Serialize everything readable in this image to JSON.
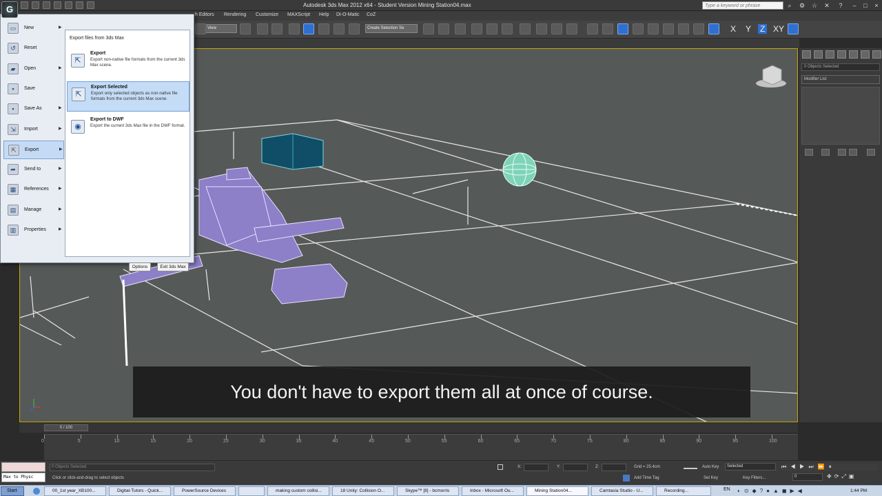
{
  "window": {
    "title": "Autodesk 3ds Max 2012 x64 - Student Version    Mining Station04.max"
  },
  "search": {
    "placeholder": "Type a keyword or phrase"
  },
  "menubar": {
    "items": [
      "h Editors",
      "Rendering",
      "Customize",
      "MAXScript",
      "Help",
      "Di-O-Matic",
      "CoZ"
    ]
  },
  "toolbar": {
    "view_label": "View",
    "selection_set": "Create Selection Se",
    "axes": [
      "X",
      "Y",
      "Z",
      "XY"
    ]
  },
  "app_menu": {
    "items": [
      {
        "label": "New",
        "icon": "new-file-icon",
        "arrow": true
      },
      {
        "label": "Reset",
        "icon": "reset-icon",
        "arrow": false
      },
      {
        "label": "Open",
        "icon": "open-folder-icon",
        "arrow": true
      },
      {
        "label": "Save",
        "icon": "save-icon",
        "arrow": false
      },
      {
        "label": "Save As",
        "icon": "save-as-icon",
        "arrow": true
      },
      {
        "label": "Import",
        "icon": "import-icon",
        "arrow": true
      },
      {
        "label": "Export",
        "icon": "export-icon",
        "arrow": true
      },
      {
        "label": "Send to",
        "icon": "send-to-icon",
        "arrow": true
      },
      {
        "label": "References",
        "icon": "references-icon",
        "arrow": true
      },
      {
        "label": "Manage",
        "icon": "manage-icon",
        "arrow": true
      },
      {
        "label": "Properties",
        "icon": "properties-icon",
        "arrow": true
      }
    ],
    "selected_index": 6,
    "submenu": {
      "header": "Export files from 3ds Max",
      "items": [
        {
          "title": "Export",
          "desc": "Export non-native file formats from the current 3ds Max scene."
        },
        {
          "title": "Export Selected",
          "desc": "Export only selected objects as non-native file formats from the current 3ds Max scene."
        },
        {
          "title": "Export to DWF",
          "desc": "Export the current 3ds Max file in the DWF format."
        }
      ]
    },
    "options_label": "Options",
    "exit_label": "Exit 3ds Max"
  },
  "command_panel": {
    "selection": "0 Objects Selected",
    "modifier_list": "Modifier List"
  },
  "caption": "You don't have to export them all at once of course.",
  "timeline": {
    "slider": "0 / 100",
    "ticks": [
      0,
      5,
      10,
      15,
      20,
      25,
      30,
      35,
      40,
      45,
      50,
      55,
      60,
      65,
      70,
      75,
      80,
      85,
      90,
      95,
      100
    ]
  },
  "status": {
    "maxscript": "Max to Physc",
    "objects_selected": "0 Objects Selected",
    "prompt": "Click or click-and-drag to select objects",
    "x_label": "X:",
    "y_label": "Y:",
    "z_label": "Z:",
    "grid": "Grid = 25.4cm",
    "add_time_tag": "Add Time Tag",
    "auto_key": "Auto Key",
    "set_key": "Set Key",
    "key_mode": "Selected",
    "key_filters": "Key Filters...",
    "frame": "0"
  },
  "taskbar": {
    "start": "Start",
    "tasks": [
      "00_1st year_XB100...",
      "Digital-Tutors - Quick...",
      "PowerSource Devices",
      "",
      "making custom collisi...",
      "18 Unity: Collision O...",
      "Skype™ [8] - bcmorris",
      "Inbox - Microsoft Ou...",
      "Mining Station04...",
      "Camtasia Studio - U...",
      "Recording..."
    ],
    "active_index": 8,
    "language": "EN",
    "clock": "1:44 PM"
  }
}
